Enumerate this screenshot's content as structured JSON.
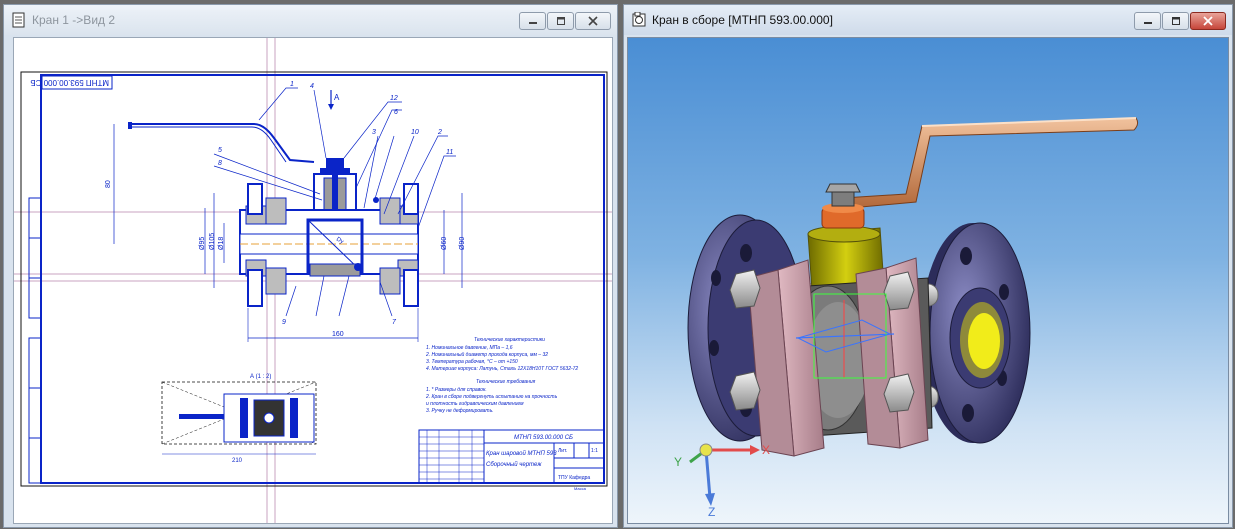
{
  "window_left": {
    "title": "Кран 1 ->Вид 2",
    "drawing": {
      "code_stamp": "МТНП 593.00.000 СБ",
      "view_label": "А",
      "view_label_small": "А (1 : 2)",
      "dimensions": {
        "d_half": "Dу",
        "height_left": "80",
        "overall_len": "160",
        "bottom_len": "210",
        "dia_a": "Ø95",
        "dia_b": "Ø105",
        "dia_c": "Ø18",
        "dia_d": "Ø60",
        "dia_e": "Ø90"
      },
      "position_numbers": [
        "1",
        "4",
        "12",
        "6",
        "5",
        "8",
        "3",
        "10",
        "2",
        "11",
        "9",
        "7",
        "3"
      ],
      "notes_title": "Технические характеристики",
      "notes": [
        "1. Номинальное давление, МПа – 1,6",
        "2. Номинальный диаметр прохода корпуса, мм – 32",
        "3. Температура рабочая, °С – от +150",
        "4. Материал корпуса: Латунь, Сталь 12Х18Н10Т ГОСТ 5632-72"
      ],
      "req_title": "Технические требования",
      "requirements": [
        "1. * Размеры для справок.",
        "2. Кран в сборе подвергнуть испытанию на прочность",
        "   и плотность гидравлическим давлением",
        "3. Ручку не деформировать."
      ],
      "title_block": {
        "code": "МТНП 593.00.000 СБ",
        "name_line1": "Кран шаровой МТНП 593",
        "name_line2": "Сборочный чертеж",
        "lit": "Лит.",
        "mass": "Масса",
        "scale": "1:1",
        "org": "ТПУ Кафедра"
      }
    }
  },
  "window_right": {
    "title": "Кран в сборе [МТНП 593.00.000]",
    "axes": {
      "x": "X",
      "y": "Y",
      "z": "Z"
    }
  },
  "colors": {
    "drawing_blue": "#0a24c8",
    "handle": "#e2a172",
    "nut": "#e06a2a",
    "yellow_part": "#c8c200",
    "flange": "#55558f",
    "plate": "#c79aa6",
    "bolt": "#bdbdbd"
  }
}
